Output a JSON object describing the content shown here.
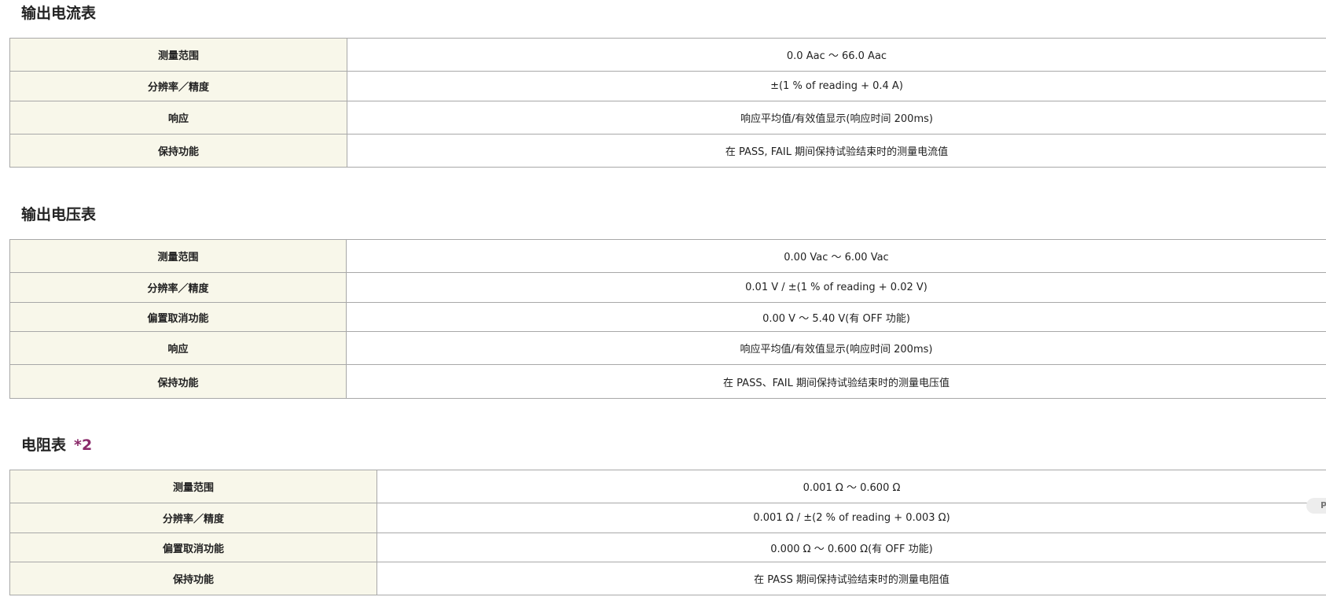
{
  "sections": [
    {
      "title": "输出电流表",
      "rows": [
        {
          "label": "测量范围",
          "value": "0.0 Aac ～ 66.0 Aac"
        },
        {
          "label": "分辨率／精度",
          "value": "±(1 % of reading + 0.4 A)"
        },
        {
          "label": "响应",
          "value": "响应平均值/有效值显示(响应时间 200ms)"
        },
        {
          "label": "保持功能",
          "value": "在 PASS, FAIL 期间保持试验结束时的测量电流值"
        }
      ]
    },
    {
      "title": "输出电压表",
      "rows": [
        {
          "label": "测量范围",
          "value": "0.00 Vac ～ 6.00 Vac"
        },
        {
          "label": "分辨率／精度",
          "value": "0.01 V / ±(1 % of reading + 0.02 V)"
        },
        {
          "label": "偏置取消功能",
          "value": "0.00 V ～ 5.40 V(有 OFF 功能)"
        },
        {
          "label": "响应",
          "value": "响应平均值/有效值显示(响应时间 200ms)"
        },
        {
          "label": "保持功能",
          "value": "在 PASS、FAIL 期间保持试验结束时的测量电压值"
        }
      ]
    },
    {
      "title": "电阻表",
      "note": "*2",
      "rows": [
        {
          "label": "测量范围",
          "value": "0.001 Ω ～ 0.600 Ω"
        },
        {
          "label": "分辨率／精度",
          "value": "0.001 Ω / ±(2 % of reading + 0.003 Ω)"
        },
        {
          "label": "偏置取消功能",
          "value": "0.000 Ω ～ 0.600 Ω(有 OFF 功能)"
        },
        {
          "label": "保持功能",
          "value": "在 PASS 期间保持试验结束时的测量电阻值"
        }
      ]
    }
  ],
  "edge_tab": {
    "label": "P"
  }
}
